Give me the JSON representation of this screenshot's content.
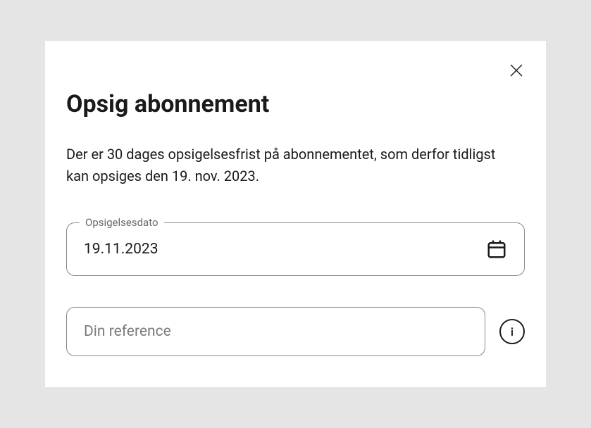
{
  "modal": {
    "title": "Opsig abonnement",
    "description": "Der er 30 dages opsigelsesfrist på abonnementet, som derfor tidligst kan opsiges den 19. nov. 2023.",
    "dateField": {
      "label": "Opsigelsesdato",
      "value": "19.11.2023"
    },
    "referenceField": {
      "placeholder": "Din reference",
      "value": ""
    }
  }
}
